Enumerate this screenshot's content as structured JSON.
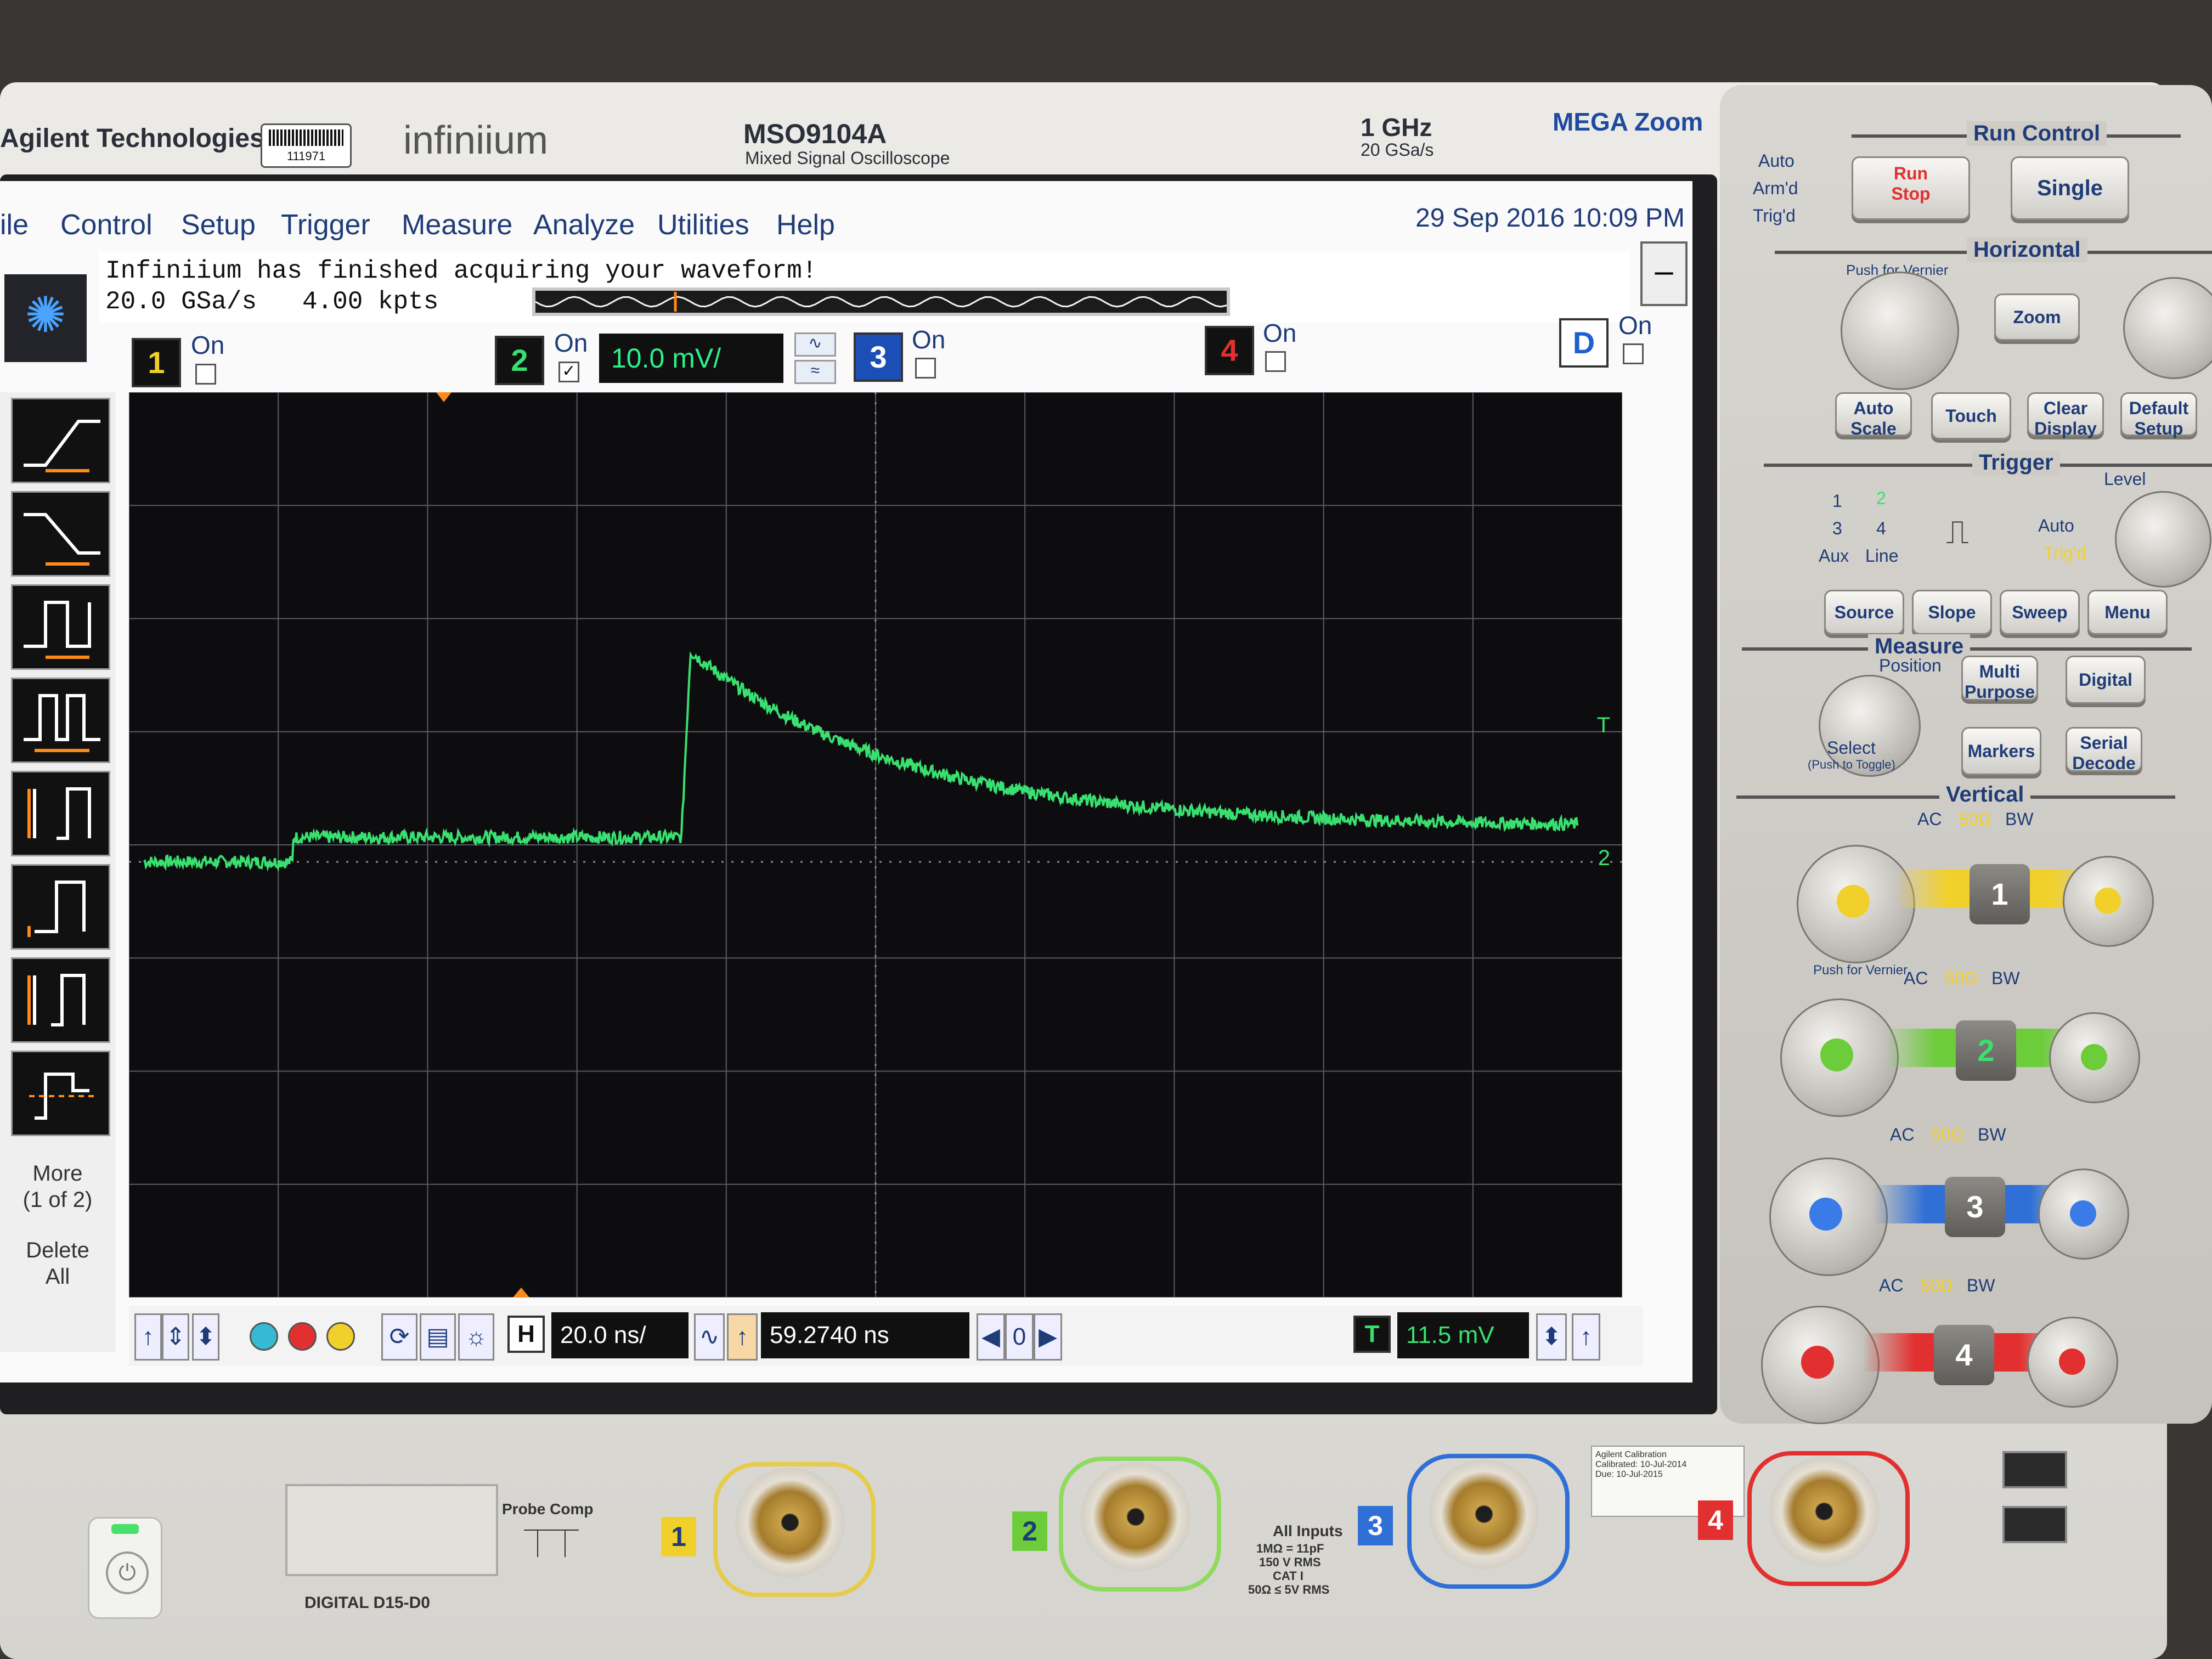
{
  "instrument": {
    "brand": "Agilent Technologies",
    "asset_tag": "111971",
    "series": "infiniium",
    "model": "MSO9104A",
    "model_desc": "Mixed Signal Oscilloscope",
    "bandwidth": "1 GHz",
    "sample_rate_spec": "20 GSa/s",
    "megazoom": "MEGA Zoom"
  },
  "menu": {
    "items": [
      "ile",
      "Control",
      "Setup",
      "Trigger",
      "Measure",
      "Analyze",
      "Utilities",
      "Help"
    ],
    "datetime": "29 Sep 2016 10:09 PM"
  },
  "status": {
    "message": "Infiniium has finished acquiring your waveform!",
    "sample_rate": "20.0 GSa/s",
    "points": "4.00 kpts"
  },
  "channels": [
    {
      "id": "1",
      "on_label": "On",
      "checked": false,
      "color": "#f2d02b"
    },
    {
      "id": "2",
      "on_label": "On",
      "checked": true,
      "color": "#39e070",
      "scale": "10.0 mV/"
    },
    {
      "id": "3",
      "on_label": "On",
      "checked": false,
      "color": "#3a7be8"
    },
    {
      "id": "4",
      "on_label": "On",
      "checked": false,
      "color": "#e23030"
    },
    {
      "id": "D",
      "on_label": "On",
      "checked": false,
      "color": "#1f5fd0"
    }
  ],
  "toolbar": {
    "more_label": "More",
    "more_sub": "(1 of 2)",
    "delete_label": "Delete",
    "delete_sub": "All"
  },
  "bottom": {
    "h_label": "H",
    "timebase": "20.0 ns/",
    "delay": "59.2740 ns",
    "zero": "0",
    "t_label": "T",
    "trigger_level": "11.5 mV"
  },
  "markers": {
    "trigger": "T",
    "ch2": "2"
  },
  "waveform": {
    "channel": "2",
    "color": "#39e070",
    "baseline": 0.0,
    "step_level": 0.35,
    "peak": 3.0,
    "final": 0.5,
    "rise_div": 3.7,
    "grid_divs_x": 10,
    "grid_divs_y": 8
  },
  "panel": {
    "run_control": "Run Control",
    "auto": "Auto",
    "armd": "Arm'd",
    "trigd": "Trig'd",
    "run": "Run",
    "stop": "Stop",
    "single": "Single",
    "horizontal": "Horizontal",
    "push_vernier": "Push for Vernier",
    "zoom": "Zoom",
    "auto_scale": "Auto Scale",
    "touch": "Touch",
    "clear_display": "Clear Display",
    "default_setup": "Default Setup",
    "trigger": "Trigger",
    "level": "Level",
    "src_1": "1",
    "src_2": "2",
    "src_3": "3",
    "src_4": "4",
    "aux": "Aux",
    "line": "Line",
    "trig_auto": "Auto",
    "trig_trigd": "Trig'd",
    "source": "Source",
    "slope": "Slope",
    "sweep": "Sweep",
    "menu": "Menu",
    "measure": "Measure",
    "position": "Position",
    "multi_purpose": "Multi Purpose",
    "digital": "Digital",
    "select": "Select",
    "push_toggle": "(Push to Toggle)",
    "markers": "Markers",
    "serial_decode": "Serial Decode",
    "vertical": "Vertical",
    "ac": "AC",
    "ohm": "50Ω",
    "bw": "BW",
    "push_vernier2": "Push for Vernier"
  },
  "front": {
    "digital": "DIGITAL D15-D0",
    "probe_comp": "Probe Comp",
    "all_inputs": "All Inputs",
    "input_spec": "1MΩ = 11pF",
    "rms": "150 V RMS",
    "cat": "CAT I",
    "ohm_spec": "50Ω ≤ 5V RMS",
    "cal_title": "Agilent Calibration",
    "cal_date": "Calibrated: 10-Jul-2014",
    "cal_due": "Due: 10-Jul-2015"
  }
}
